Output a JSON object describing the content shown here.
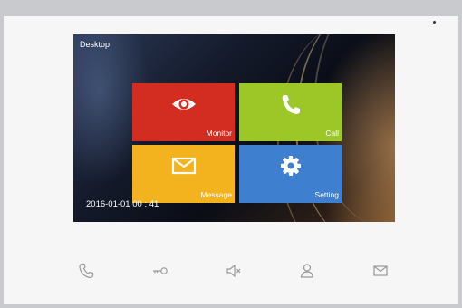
{
  "screen": {
    "title": "Desktop",
    "datetime": "2016-01-01  00 : 41"
  },
  "tiles": [
    {
      "label": "Monitor",
      "icon": "eye-icon",
      "color": "#d32d22"
    },
    {
      "label": "Call",
      "icon": "phone-icon",
      "color": "#9dc627"
    },
    {
      "label": "Message",
      "icon": "envelope-icon",
      "color": "#f2b31e"
    },
    {
      "label": "Setting",
      "icon": "gear-icon",
      "color": "#3f7fcf"
    }
  ],
  "bottom_bar": [
    {
      "icon": "phone-icon"
    },
    {
      "icon": "key-icon"
    },
    {
      "icon": "speaker-mute-icon"
    },
    {
      "icon": "user-icon"
    },
    {
      "icon": "envelope-icon"
    }
  ],
  "colors": {
    "bezel": "#f6f6f6",
    "backdrop": "#c9cacd",
    "bottom_icon_stroke": "#9a9a9a"
  }
}
